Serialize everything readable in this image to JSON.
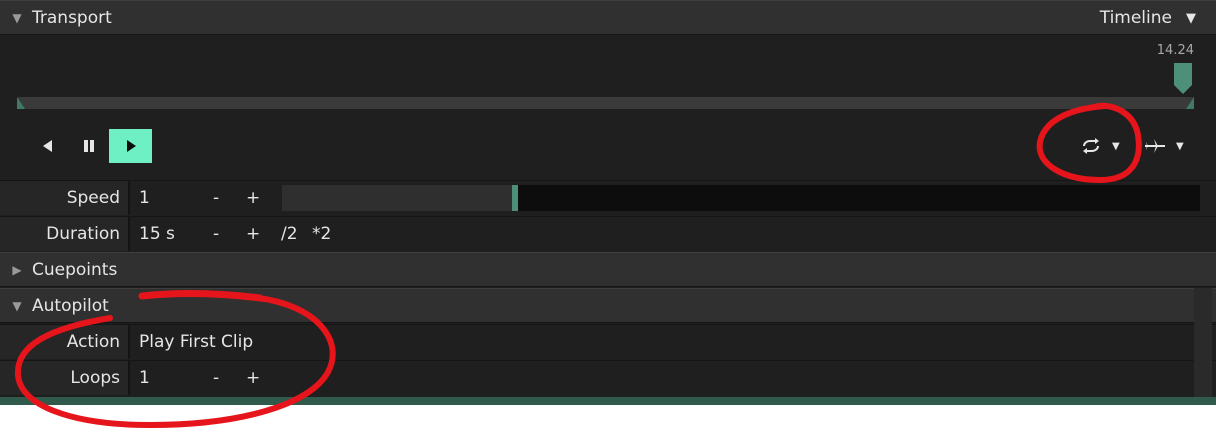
{
  "transport": {
    "title": "Transport",
    "view_selector": "Timeline",
    "time_readout": "14.24"
  },
  "timeline": {
    "playhead_fraction": 0.994
  },
  "controls": {
    "loop_dropdown": "loop-icon",
    "plane_dropdown": "airplane-icon"
  },
  "speed": {
    "label": "Speed",
    "value": "1",
    "minus": "-",
    "plus": "+",
    "slider_fraction": 0.25
  },
  "duration": {
    "label": "Duration",
    "value": "15 s",
    "minus": "-",
    "plus": "+",
    "half": "/2",
    "double": "*2"
  },
  "cuepoints": {
    "title": "Cuepoints"
  },
  "autopilot": {
    "title": "Autopilot",
    "action": {
      "label": "Action",
      "value": "Play First Clip"
    },
    "loops": {
      "label": "Loops",
      "value": "1",
      "minus": "-",
      "plus": "+"
    }
  },
  "colors": {
    "accent": "#6ef0c4",
    "marker": "#4e8f7a",
    "annotation": "#e5151b"
  }
}
